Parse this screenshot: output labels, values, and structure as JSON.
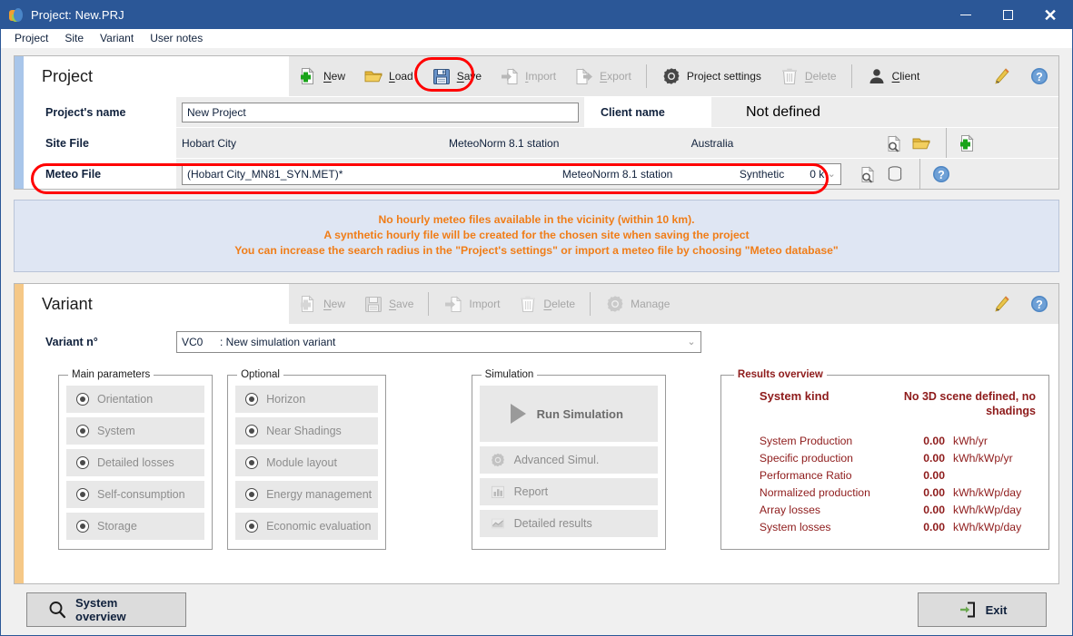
{
  "window": {
    "title": "Project: New.PRJ",
    "app_icon": "pvsyst-logo-icon",
    "minimize": "minimize-button",
    "maximize": "maximize-button",
    "close": "✕"
  },
  "menubar": {
    "items": [
      {
        "label": "Project"
      },
      {
        "label": "Site"
      },
      {
        "label": "Variant"
      },
      {
        "label": "User notes"
      }
    ]
  },
  "project_panel": {
    "title": "Project",
    "toolbar": [
      {
        "label": "New",
        "icon": "new-file-icon",
        "disabled": false
      },
      {
        "label": "Load",
        "icon": "open-folder-icon",
        "disabled": false
      },
      {
        "label": "Save",
        "icon": "save-disk-icon",
        "disabled": false
      },
      {
        "label": "Import",
        "icon": "import-arrow-icon",
        "disabled": true
      },
      {
        "label": "Export",
        "icon": "export-arrow-icon",
        "disabled": true
      },
      {
        "label": "Project settings",
        "icon": "gear-icon",
        "disabled": false
      },
      {
        "label": "Delete",
        "icon": "trash-icon",
        "disabled": true
      },
      {
        "label": "Client",
        "icon": "person-icon",
        "disabled": false
      }
    ],
    "edit_icon": "pencil-icon",
    "help_icon": "help-question-icon",
    "fields": {
      "project_name": {
        "label": "Project's name",
        "value": "New Project"
      },
      "client_name": {
        "label": "Client name",
        "value": "Not defined"
      },
      "site_file": {
        "label": "Site File",
        "name": "Hobart City",
        "source": "MeteoNorm 8.1 station",
        "country": "Australia"
      },
      "meteo_file": {
        "label": "Meteo File",
        "name": "(Hobart City_MN81_SYN.MET)*",
        "source": "MeteoNorm 8.1 station",
        "kind": "Synthetic",
        "distance": "0 k"
      }
    }
  },
  "warning": {
    "color": "#f07d18",
    "lines": [
      "No hourly meteo files available in the vicinity (within 10 km).",
      "A synthetic hourly file will be created for the chosen site when saving the project",
      "You can increase the search radius in the \"Project's settings\" or import a meteo file by choosing \"Meteo database\""
    ]
  },
  "variant_panel": {
    "title": "Variant",
    "toolbar": [
      {
        "label": "New",
        "icon": "new-file-icon",
        "disabled": true
      },
      {
        "label": "Save",
        "icon": "save-disk-icon",
        "disabled": true
      },
      {
        "label": "Import",
        "icon": "import-arrow-icon",
        "disabled": true
      },
      {
        "label": "Delete",
        "icon": "trash-icon",
        "disabled": true
      },
      {
        "label": "Manage",
        "icon": "gear-icon",
        "disabled": true
      }
    ],
    "edit_icon": "pencil-icon",
    "help_icon": "help-question-icon",
    "variant_no": {
      "label": "Variant n°",
      "code": "VC0",
      "description": ": New simulation variant"
    },
    "main_parameters": {
      "legend": "Main parameters",
      "items": [
        {
          "label": "Orientation"
        },
        {
          "label": "System"
        },
        {
          "label": "Detailed losses"
        },
        {
          "label": "Self-consumption"
        },
        {
          "label": "Storage"
        }
      ]
    },
    "optional": {
      "legend": "Optional",
      "items": [
        {
          "label": "Horizon"
        },
        {
          "label": "Near Shadings"
        },
        {
          "label": "Module layout"
        },
        {
          "label": "Energy management"
        },
        {
          "label": "Economic evaluation"
        }
      ]
    },
    "simulation": {
      "legend": "Simulation",
      "run_label": "Run Simulation",
      "run_icon": "play-triangle-icon",
      "items": [
        {
          "label": "Advanced Simul.",
          "icon": "gear-icon"
        },
        {
          "label": "Report",
          "icon": "bar-chart-icon"
        },
        {
          "label": "Detailed results",
          "icon": "line-chart-icon"
        }
      ]
    },
    "results": {
      "legend": "Results overview",
      "color": "#8e1b1b",
      "system_kind_label": "System kind",
      "system_kind_value": "No 3D scene defined, no shadings",
      "rows": [
        {
          "label": "System Production",
          "value": "0.00",
          "unit": "kWh/yr"
        },
        {
          "label": "Specific production",
          "value": "0.00",
          "unit": "kWh/kWp/yr"
        },
        {
          "label": "Performance Ratio",
          "value": "0.00",
          "unit": ""
        },
        {
          "label": "Normalized production",
          "value": "0.00",
          "unit": "kWh/kWp/day"
        },
        {
          "label": "Array losses",
          "value": "0.00",
          "unit": "kWh/kWp/day"
        },
        {
          "label": "System losses",
          "value": "0.00",
          "unit": "kWh/kWp/day"
        }
      ]
    }
  },
  "bottom": {
    "system_overview": {
      "label": "System overview",
      "icon": "magnifier-icon"
    },
    "exit": {
      "label": "Exit",
      "icon": "exit-door-icon"
    }
  },
  "annotations": {
    "save_highlight": "red-circle-around-save-button",
    "meteo_highlight": "red-circle-around-meteo-file-row"
  }
}
